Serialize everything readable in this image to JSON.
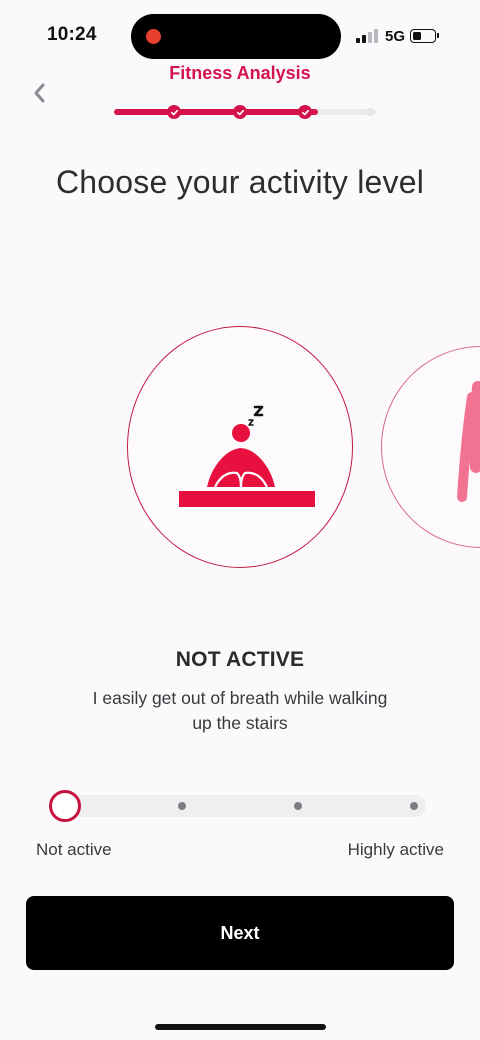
{
  "status_bar": {
    "time": "10:24",
    "network": "5G"
  },
  "header": {
    "title": "Fitness Analysis",
    "progress": {
      "completed_steps": 3,
      "total_steps": 4
    }
  },
  "page": {
    "title": "Choose your activity level"
  },
  "selected_level": {
    "name": "NOT ACTIVE",
    "description": "I easily get out of breath while walking up the stairs"
  },
  "slider": {
    "min_label": "Not active",
    "max_label": "Highly active",
    "positions": 4,
    "selected_index": 0
  },
  "actions": {
    "next_label": "Next"
  },
  "colors": {
    "accent": "#d4134c",
    "button_bg": "#000000",
    "background": "#fbf9fc"
  },
  "icons": {
    "back": "chevron-left-icon",
    "step_done": "check-icon",
    "sleeping_person": "sleeping-person-icon",
    "sleep": "zzz-icon"
  }
}
